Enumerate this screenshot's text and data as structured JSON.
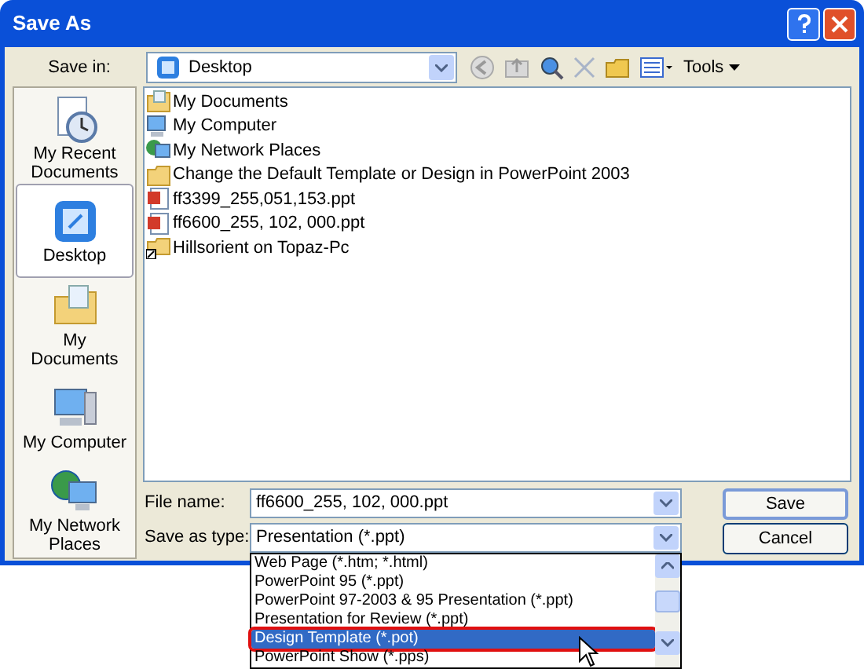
{
  "window": {
    "title": "Save As"
  },
  "save_in": {
    "label": "Save in:",
    "value": "Desktop"
  },
  "toolbar": {
    "tools_label": "Tools"
  },
  "places": [
    {
      "label": "My Recent Documents",
      "kind": "recent",
      "selected": false
    },
    {
      "label": "Desktop",
      "kind": "desktop",
      "selected": true
    },
    {
      "label": "My Documents",
      "kind": "documents",
      "selected": false
    },
    {
      "label": "My Computer",
      "kind": "computer",
      "selected": false
    },
    {
      "label": "My Network Places",
      "kind": "network",
      "selected": false
    }
  ],
  "files": [
    {
      "name": "My Documents",
      "kind": "documents"
    },
    {
      "name": "My Computer",
      "kind": "computer"
    },
    {
      "name": "My Network Places",
      "kind": "network"
    },
    {
      "name": "Change the Default Template or Design in PowerPoint 2003",
      "kind": "folder"
    },
    {
      "name": "ff3399_255,051,153.ppt",
      "kind": "ppt"
    },
    {
      "name": "ff6600_255, 102, 000.ppt",
      "kind": "ppt"
    },
    {
      "name": "Hillsorient on Topaz-Pc",
      "kind": "share"
    }
  ],
  "file_name": {
    "label": "File name:",
    "value": "ff6600_255, 102, 000.ppt"
  },
  "save_as_type": {
    "label": "Save as type:",
    "value": "Presentation (*.ppt)"
  },
  "type_options": [
    {
      "label": "Web Page (*.htm; *.html)",
      "selected": false
    },
    {
      "label": "PowerPoint 95 (*.ppt)",
      "selected": false
    },
    {
      "label": "PowerPoint 97-2003 & 95 Presentation (*.ppt)",
      "selected": false
    },
    {
      "label": "Presentation for Review (*.ppt)",
      "selected": false
    },
    {
      "label": "Design Template (*.pot)",
      "selected": true
    },
    {
      "label": "PowerPoint Show (*.pps)",
      "selected": false
    }
  ],
  "buttons": [
    "Save",
    "Cancel"
  ]
}
